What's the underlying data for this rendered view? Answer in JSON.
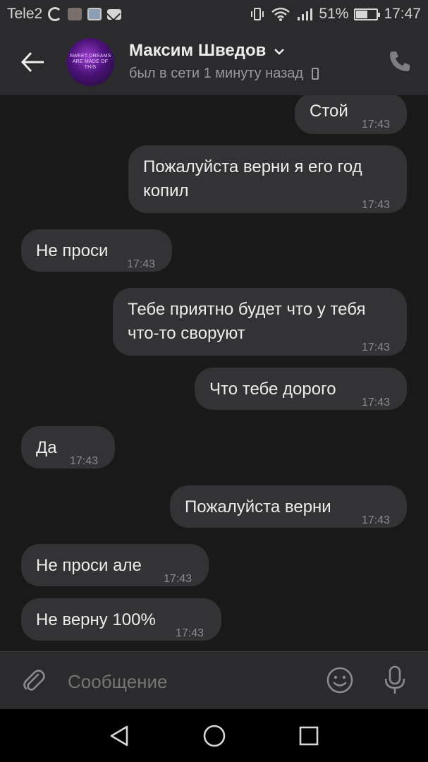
{
  "status_bar": {
    "carrier": "Tele2",
    "battery_percent": "51%",
    "battery_level": 0.51,
    "time": "17:47"
  },
  "header": {
    "contact_name": "Максим Шведов",
    "contact_status": "был в сети 1 минуту назад",
    "avatar_text": "SWEET DREAMS ARE MADE OF THIS"
  },
  "messages": [
    {
      "direction": "outgoing",
      "text": "Стой",
      "time": "17:43"
    },
    {
      "direction": "outgoing",
      "text": "Пожалуйста верни я его год",
      "text2": "копил",
      "time": "17:43"
    },
    {
      "direction": "incoming",
      "text": "Не проси",
      "time": "17:43"
    },
    {
      "direction": "outgoing",
      "text": "Тебе приятно будет что у тебя",
      "text2": "что-то своруют",
      "time": "17:43"
    },
    {
      "direction": "outgoing",
      "text": "Что тебе дорого",
      "time": "17:43"
    },
    {
      "direction": "incoming",
      "text": "Да",
      "time": "17:43"
    },
    {
      "direction": "outgoing",
      "text": "Пожалуйста верни",
      "time": "17:43"
    },
    {
      "direction": "incoming",
      "text": "Не проси але",
      "time": "17:43"
    },
    {
      "direction": "incoming",
      "text": "Не верну 100%",
      "time": "17:43"
    }
  ],
  "composer": {
    "placeholder": "Сообщение"
  },
  "icons": {
    "back": "arrow-left-icon",
    "call": "phone-icon",
    "attach": "paperclip-icon",
    "emoji": "smiley-icon",
    "mic": "microphone-icon",
    "nav_back": "triangle-back-icon",
    "nav_home": "circle-home-icon",
    "nav_recents": "square-recents-icon"
  },
  "colors": {
    "background": "#19191a",
    "bar": "#2b2b2d",
    "bubble": "#333336",
    "text": "#ececec",
    "muted": "#8b8b8f"
  }
}
